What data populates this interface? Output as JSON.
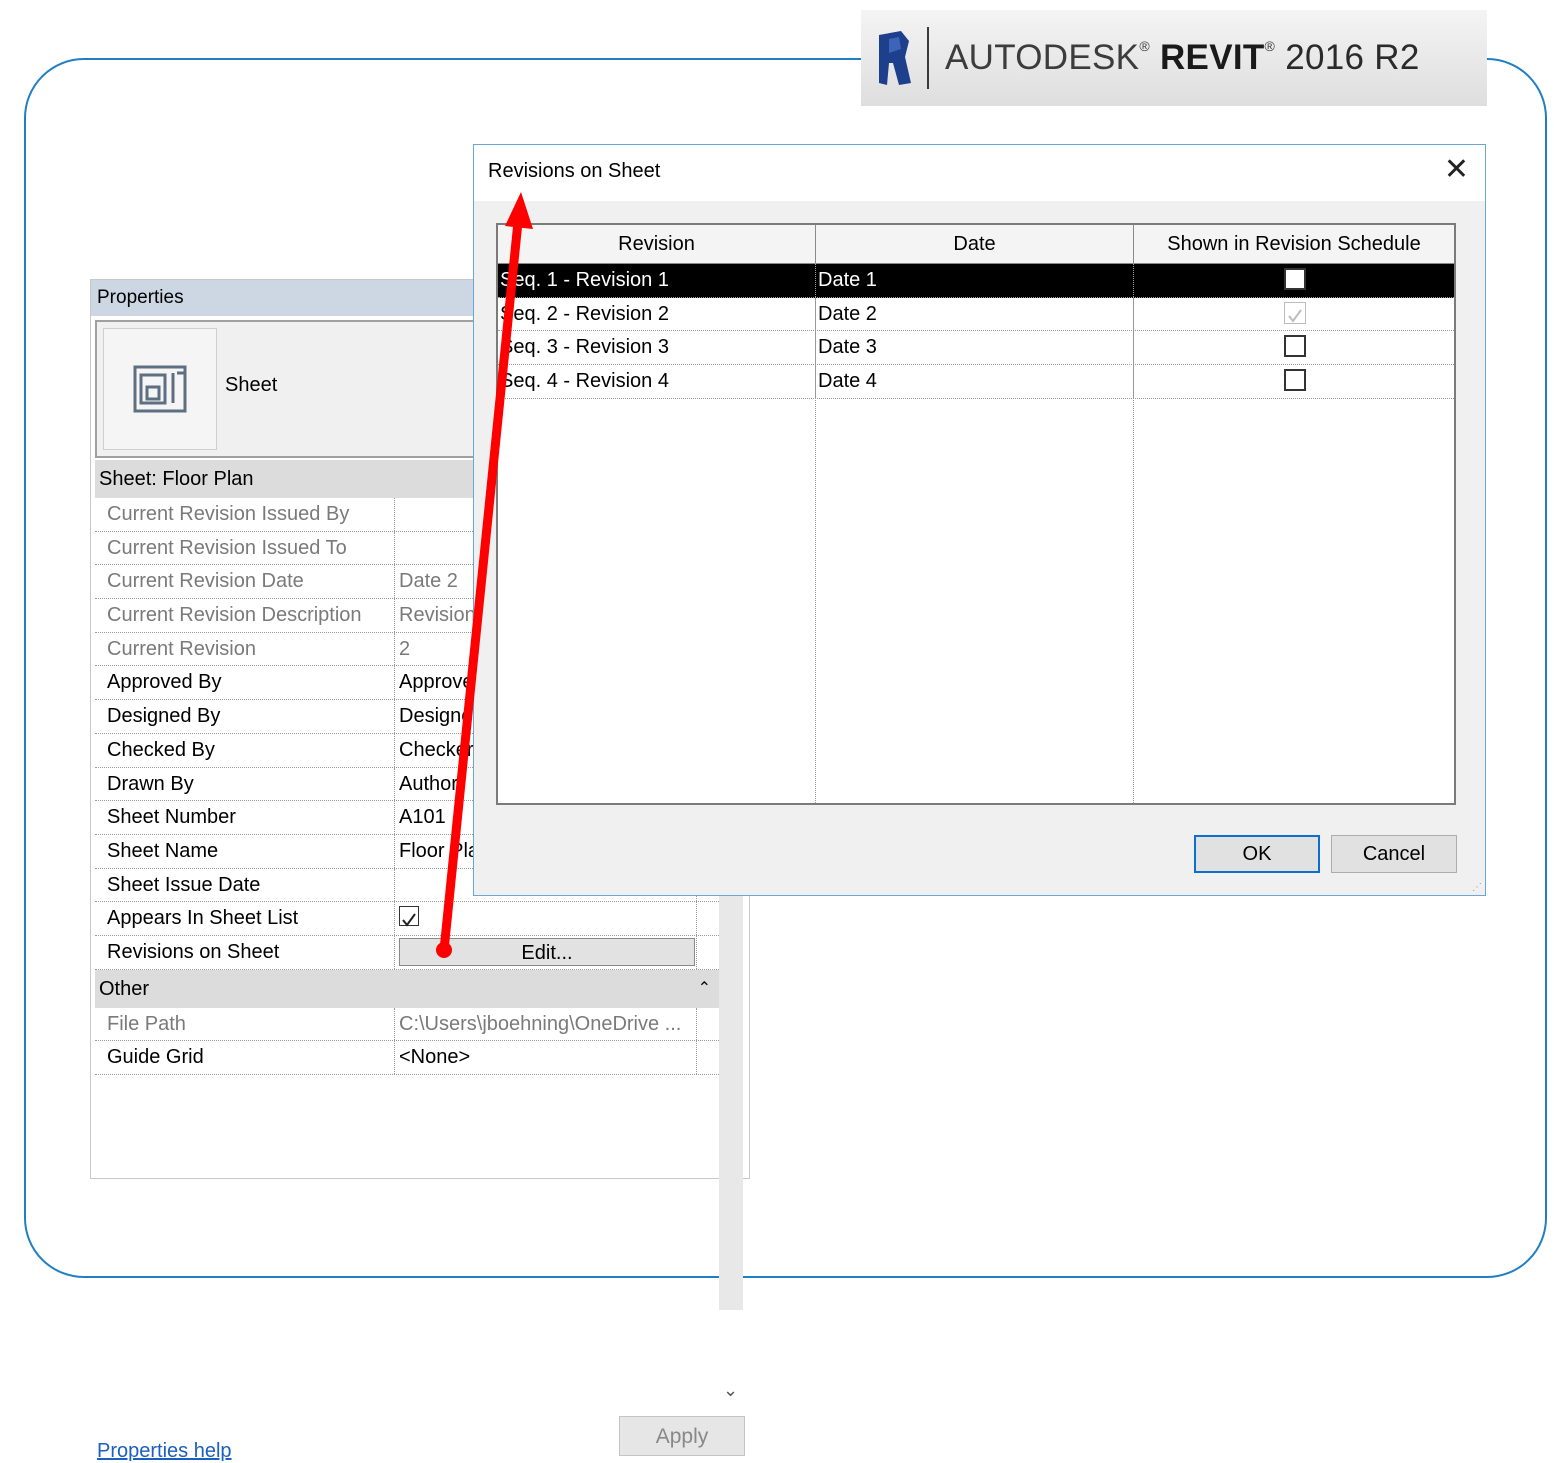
{
  "banner": {
    "brand_light": "AUTODESK",
    "brand_bold": "REVIT",
    "reg": "®",
    "version": "2016 R2"
  },
  "properties": {
    "title": "Properties",
    "type_label": "Sheet",
    "section": "Sheet: Floor Plan",
    "rows": [
      {
        "name": "Current Revision Issued By",
        "value": "",
        "dim": true
      },
      {
        "name": "Current Revision Issued To",
        "value": "",
        "dim": true
      },
      {
        "name": "Current Revision Date",
        "value": "Date 2",
        "dim": true
      },
      {
        "name": "Current Revision Description",
        "value": "Revision 2",
        "dim": true
      },
      {
        "name": "Current Revision",
        "value": "2",
        "dim": true
      },
      {
        "name": "Approved By",
        "value": "Approver",
        "dim": false
      },
      {
        "name": "Designed By",
        "value": "Designer",
        "dim": false
      },
      {
        "name": "Checked By",
        "value": "Checker",
        "dim": false
      },
      {
        "name": "Drawn By",
        "value": "Author",
        "dim": false
      },
      {
        "name": "Sheet Number",
        "value": "A101",
        "dim": false
      },
      {
        "name": "Sheet Name",
        "value": "Floor Plan",
        "dim": false
      },
      {
        "name": "Sheet Issue Date",
        "value": "",
        "dim": false
      }
    ],
    "appears_label": "Appears In Sheet List",
    "appears_checked": true,
    "revisions_label": "Revisions on Sheet",
    "edit_label": "Edit...",
    "other_header": "Other",
    "other_rows": [
      {
        "name": "File Path",
        "value": "C:\\Users\\jboehning\\OneDrive ...",
        "dim": true
      },
      {
        "name": "Guide Grid",
        "value": "<None>",
        "dim": false
      }
    ],
    "help_link": "Properties help",
    "apply_label": "Apply"
  },
  "dialog": {
    "title": "Revisions on Sheet",
    "close_glyph": "✕",
    "columns": [
      "Revision",
      "Date",
      "Shown in Revision Schedule"
    ],
    "rows": [
      {
        "revision": "Seq. 1 - Revision 1",
        "date": "Date 1",
        "shown": false,
        "selected": true,
        "disabled": false
      },
      {
        "revision": "Seq. 2 - Revision 2",
        "date": "Date 2",
        "shown": true,
        "selected": false,
        "disabled": true
      },
      {
        "revision": "Seq. 3 - Revision 3",
        "date": "Date 3",
        "shown": false,
        "selected": false,
        "disabled": false
      },
      {
        "revision": "Seq. 4 - Revision 4",
        "date": "Date 4",
        "shown": false,
        "selected": false,
        "disabled": false
      }
    ],
    "ok_label": "OK",
    "cancel_label": "Cancel"
  },
  "colors": {
    "frame": "#1f7fc2",
    "arrow": "#ff0000",
    "selection": "#000000",
    "ok_border": "#0a6fd0"
  },
  "icons": [
    "revit-logo-icon",
    "sheet-icon",
    "close-icon",
    "checkbox-icon",
    "collapse-icon",
    "scroll-down-icon",
    "resize-grip-icon"
  ]
}
